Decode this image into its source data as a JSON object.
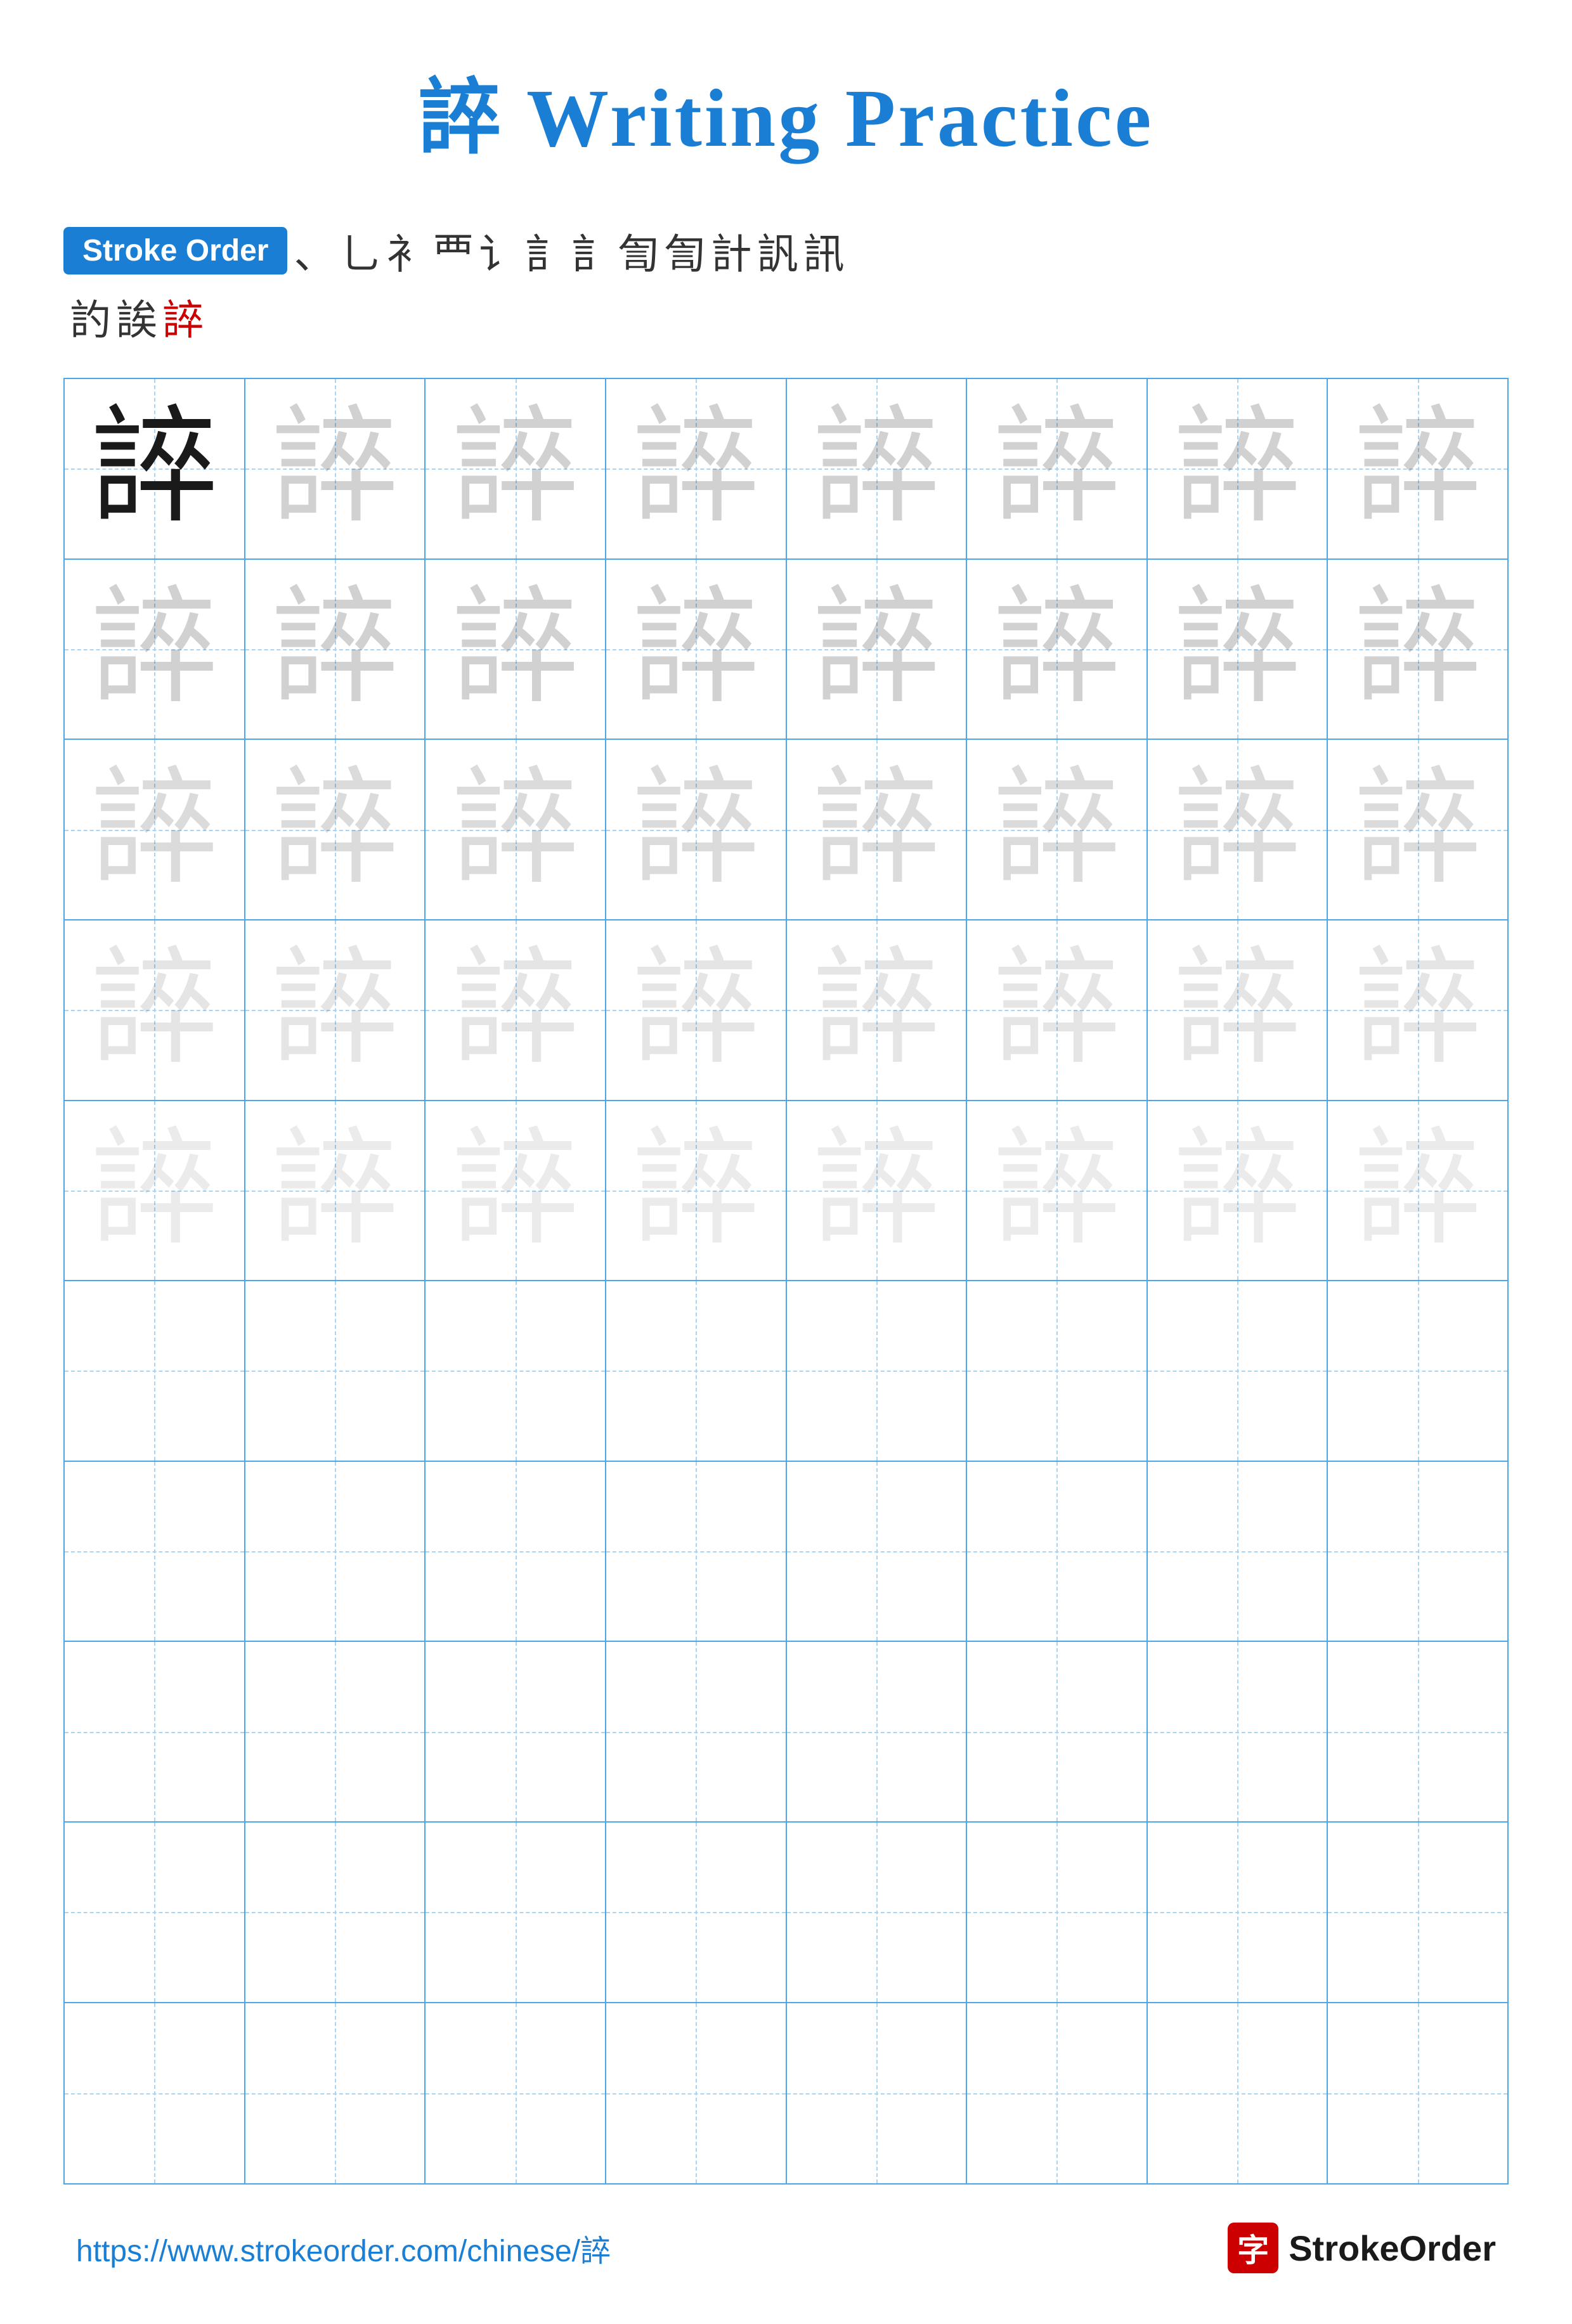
{
  "title": "誶 Writing Practice",
  "stroke_order_label": "Stroke Order",
  "stroke_sequence_row1": [
    "、",
    "⺃",
    "⻂",
    "⻃",
    "讠",
    "訁",
    "訁",
    "訇",
    "訇",
    "計",
    "訉",
    "訊"
  ],
  "stroke_sequence_row2": [
    "訋",
    "誒",
    "誶"
  ],
  "character": "誶",
  "grid_cols": 8,
  "grid_rows": 10,
  "practice_rows": [
    {
      "chars": [
        "dark",
        "light1",
        "light1",
        "light1",
        "light1",
        "light1",
        "light1",
        "light1"
      ]
    },
    {
      "chars": [
        "light1",
        "light1",
        "light1",
        "light1",
        "light1",
        "light1",
        "light1",
        "light1"
      ]
    },
    {
      "chars": [
        "light2",
        "light2",
        "light2",
        "light2",
        "light2",
        "light2",
        "light2",
        "light2"
      ]
    },
    {
      "chars": [
        "light3",
        "light3",
        "light3",
        "light3",
        "light3",
        "light3",
        "light3",
        "light3"
      ]
    },
    {
      "chars": [
        "light4",
        "light4",
        "light4",
        "light4",
        "light4",
        "light4",
        "light4",
        "light4"
      ]
    },
    {
      "chars": [
        "empty",
        "empty",
        "empty",
        "empty",
        "empty",
        "empty",
        "empty",
        "empty"
      ]
    },
    {
      "chars": [
        "empty",
        "empty",
        "empty",
        "empty",
        "empty",
        "empty",
        "empty",
        "empty"
      ]
    },
    {
      "chars": [
        "empty",
        "empty",
        "empty",
        "empty",
        "empty",
        "empty",
        "empty",
        "empty"
      ]
    },
    {
      "chars": [
        "empty",
        "empty",
        "empty",
        "empty",
        "empty",
        "empty",
        "empty",
        "empty"
      ]
    },
    {
      "chars": [
        "empty",
        "empty",
        "empty",
        "empty",
        "empty",
        "empty",
        "empty",
        "empty"
      ]
    }
  ],
  "footer": {
    "url": "https://www.strokeorder.com/chinese/誶",
    "brand_icon": "字",
    "brand_name": "StrokeOrder"
  }
}
